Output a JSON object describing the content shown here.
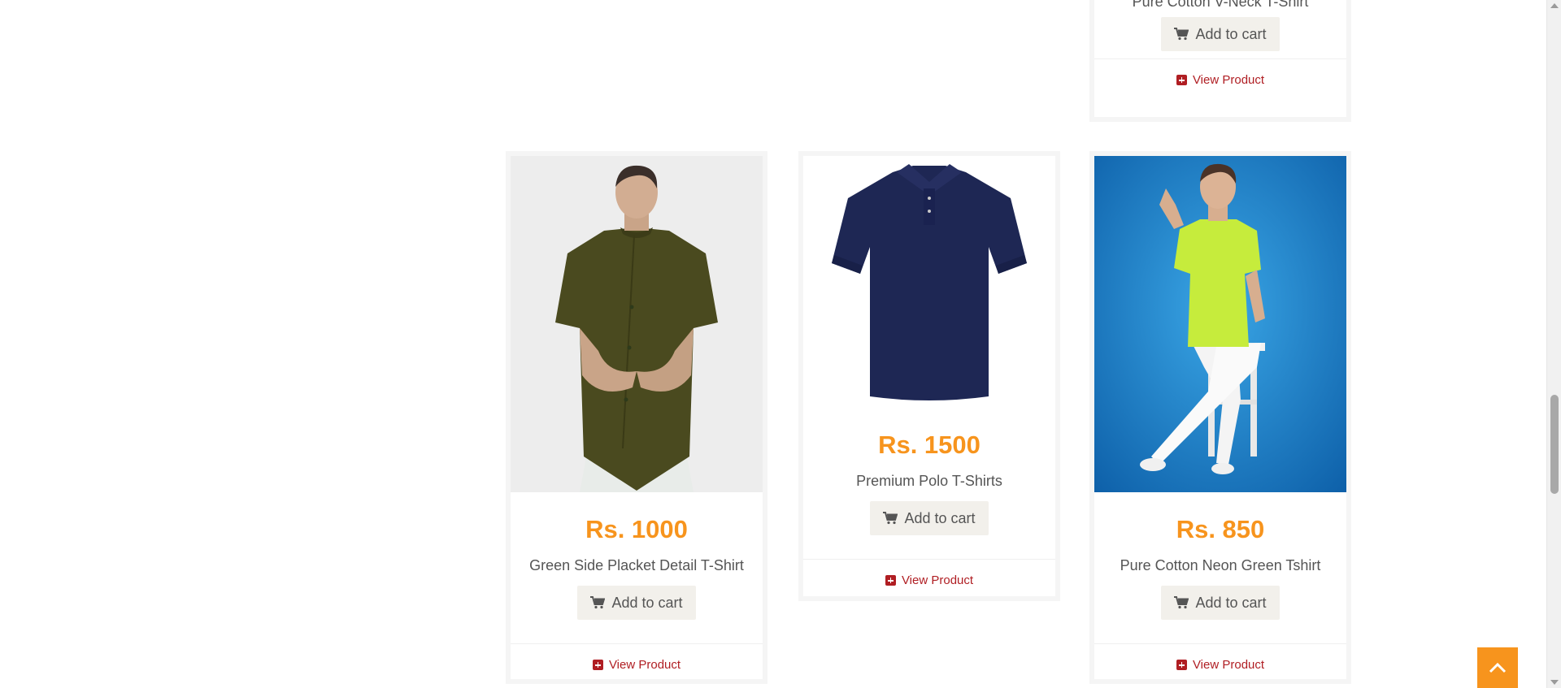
{
  "top_card": {
    "name": "Pure Cotton V-Neck T-Shirt",
    "add_to_cart_label": "Add to cart",
    "view_product_label": "View Product"
  },
  "products": [
    {
      "price": "Rs. 1000",
      "name": "Green Side Placket Detail T-Shirt",
      "add_to_cart_label": "Add to cart",
      "view_product_label": "View Product",
      "image": "olive-green-shirt-model"
    },
    {
      "price": "Rs. 1500",
      "name": "Premium Polo T-Shirts",
      "add_to_cart_label": "Add to cart",
      "view_product_label": "View Product",
      "image": "navy-polo-shirt"
    },
    {
      "price": "Rs. 850",
      "name": "Pure Cotton Neon Green Tshirt",
      "add_to_cart_label": "Add to cart",
      "view_product_label": "View Product",
      "image": "neon-green-tshirt-model"
    }
  ],
  "colors": {
    "price": "#f7941d",
    "link": "#b01e23",
    "button_bg": "#f2f0eb",
    "back_to_top": "#f7941d"
  },
  "icons": {
    "cart": "cart-icon",
    "view": "plus-square-icon",
    "back_to_top": "chevron-up-icon"
  }
}
